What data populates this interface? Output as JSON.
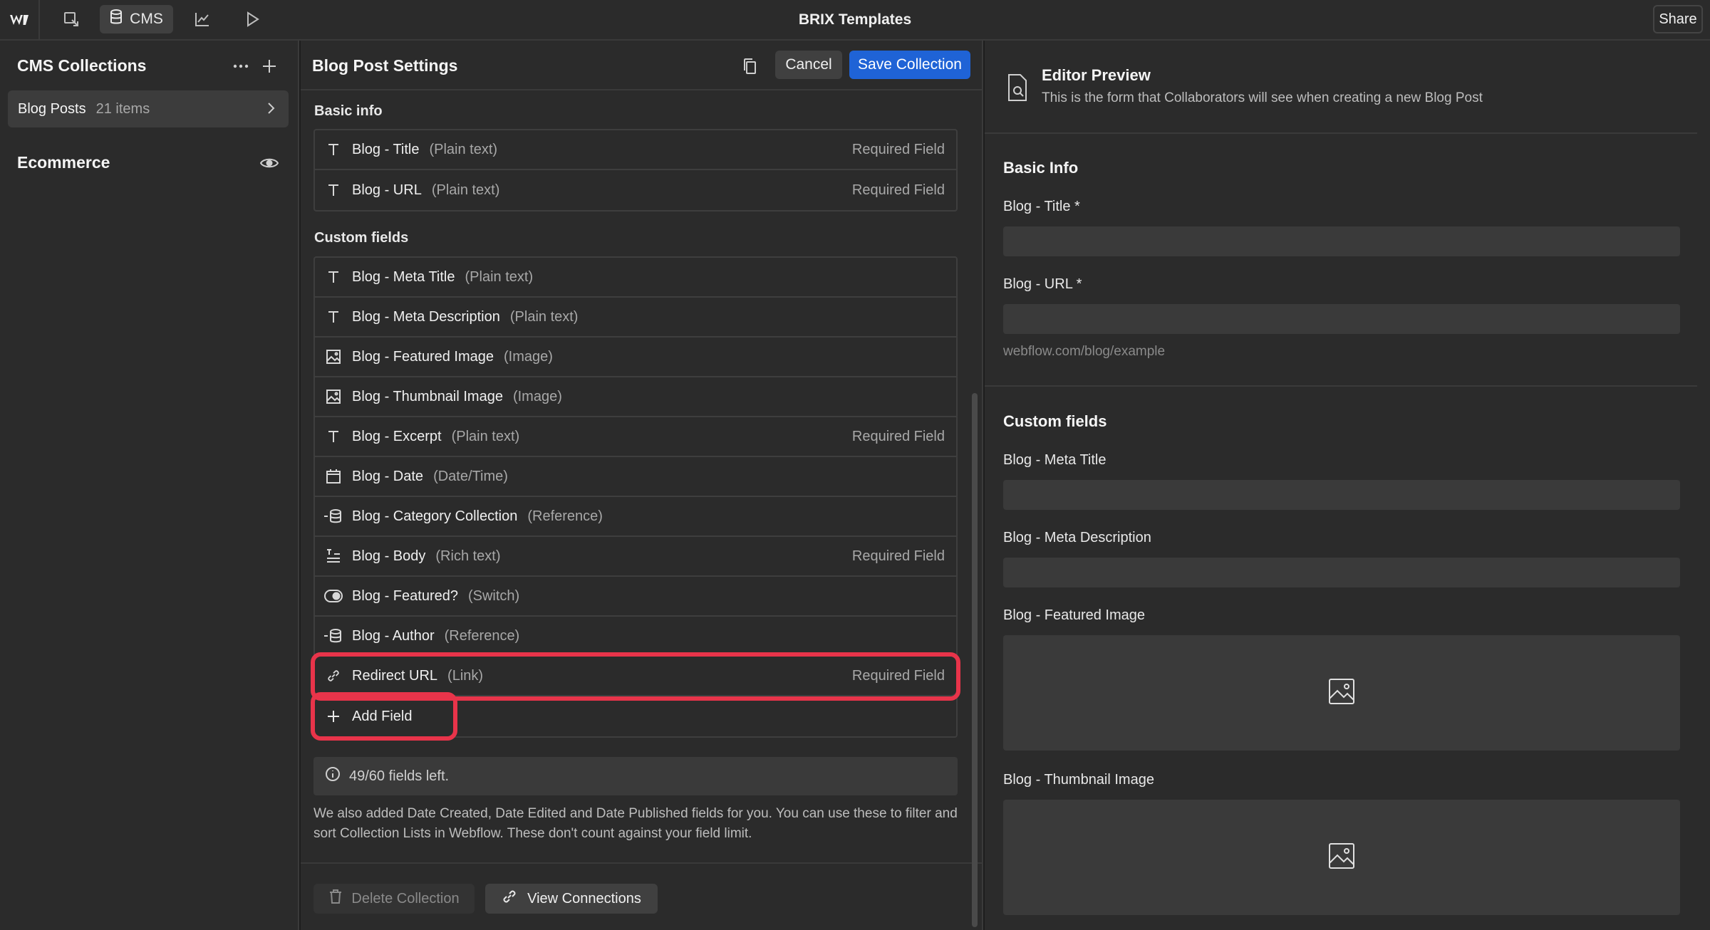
{
  "topbar": {
    "app_title": "BRIX Templates",
    "cms_label": "CMS",
    "share_label": "Share",
    "icons": [
      "webflow-logo",
      "select-icon",
      "database-icon",
      "chart-icon",
      "play-icon"
    ]
  },
  "sidebar": {
    "title": "CMS Collections",
    "collections": [
      {
        "name": "Blog Posts",
        "count": "21 items"
      }
    ],
    "ecommerce_label": "Ecommerce"
  },
  "settings": {
    "title": "Blog Post Settings",
    "cancel_label": "Cancel",
    "save_label": "Save Collection",
    "basic_info_label": "Basic info",
    "basic_fields": [
      {
        "name": "Blog - Title",
        "type": "(Plain text)",
        "required": "Required Field",
        "icon": "text-icon"
      },
      {
        "name": "Blog - URL",
        "type": "(Plain text)",
        "required": "Required Field",
        "icon": "text-icon"
      }
    ],
    "custom_fields_label": "Custom fields",
    "custom_fields": [
      {
        "name": "Blog - Meta Title",
        "type": "(Plain text)",
        "required": "",
        "icon": "text-icon"
      },
      {
        "name": "Blog - Meta Description",
        "type": "(Plain text)",
        "required": "",
        "icon": "text-icon"
      },
      {
        "name": "Blog - Featured Image",
        "type": "(Image)",
        "required": "",
        "icon": "image-icon"
      },
      {
        "name": "Blog - Thumbnail Image",
        "type": "(Image)",
        "required": "",
        "icon": "image-icon"
      },
      {
        "name": "Blog - Excerpt",
        "type": "(Plain text)",
        "required": "Required Field",
        "icon": "text-icon"
      },
      {
        "name": "Blog - Date",
        "type": "(Date/Time)",
        "required": "",
        "icon": "calendar-icon"
      },
      {
        "name": "Blog - Category Collection",
        "type": "(Reference)",
        "required": "",
        "icon": "reference-icon"
      },
      {
        "name": "Blog - Body",
        "type": "(Rich text)",
        "required": "Required Field",
        "icon": "rich-text-icon"
      },
      {
        "name": "Blog - Featured?",
        "type": "(Switch)",
        "required": "",
        "icon": "switch-icon"
      },
      {
        "name": "Blog - Author",
        "type": "(Reference)",
        "required": "",
        "icon": "reference-icon"
      },
      {
        "name": "Redirect URL",
        "type": "(Link)",
        "required": "Required Field",
        "icon": "link-icon"
      }
    ],
    "add_field_label": "Add Field",
    "fields_left": "49/60 fields left.",
    "note": "We also added Date Created, Date Edited and Date Published fields for you. You can use these to filter and sort Collection Lists in Webflow. These don't count against your field limit.",
    "delete_label": "Delete Collection",
    "connections_label": "View Connections"
  },
  "preview": {
    "title": "Editor Preview",
    "subtitle": "This is the form that Collaborators will see when creating a new Blog Post",
    "basic_heading": "Basic Info",
    "title_label": "Blog - Title *",
    "url_label": "Blog - URL *",
    "url_hint": "webflow.com/blog/example",
    "custom_heading": "Custom fields",
    "meta_title_label": "Blog - Meta Title",
    "meta_desc_label": "Blog - Meta Description",
    "featured_image_label": "Blog - Featured Image",
    "thumbnail_image_label": "Blog - Thumbnail Image"
  },
  "colors": {
    "accent": "#1f63d6",
    "highlight": "#e8344a"
  }
}
